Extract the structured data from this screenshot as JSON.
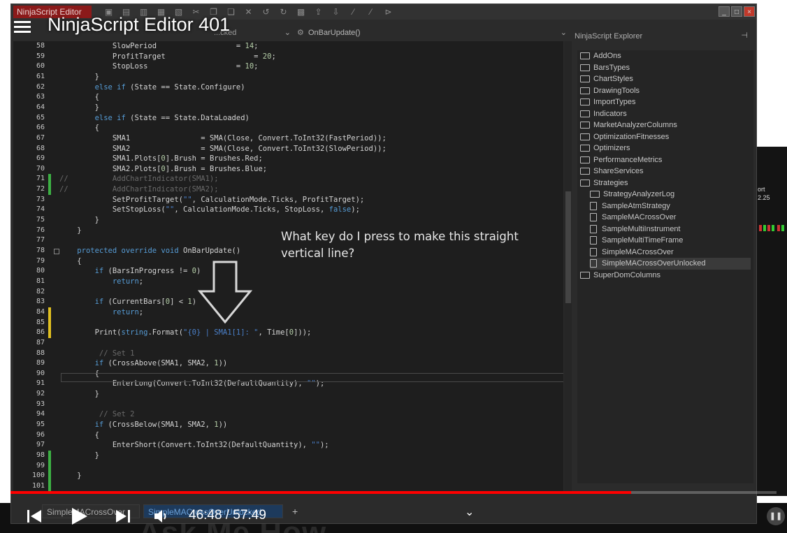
{
  "video": {
    "title": "NinjaScript Editor 401",
    "time": "46:48 / 57:49",
    "progress_fraction": 0.81,
    "accent_color": "#ff0000",
    "question": "What key do I press to make this straight vertical line?"
  },
  "window": {
    "title": "NinjaScript Editor",
    "combo_left": "...cked",
    "combo_right": "OnBarUpdate()",
    "controls": [
      "_",
      "□",
      "×"
    ]
  },
  "toolbar_icons": [
    "save-icon",
    "save-all-icon",
    "print-icon",
    "print-preview-icon",
    "properties-icon",
    "cut-icon",
    "copy-icon",
    "paste-icon",
    "delete-icon",
    "undo-icon",
    "redo-icon",
    "compile-icon",
    "export-icon",
    "import-icon",
    "comment-icon",
    "uncomment-icon",
    "vs-icon"
  ],
  "code_lines": [
    {
      "n": "58",
      "mark": "",
      "html": "            SlowPeriod                  = <span class='nm'>14</span>;"
    },
    {
      "n": "59",
      "mark": "",
      "html": "            ProfitTarget                    = <span class='nm'>20</span>;"
    },
    {
      "n": "60",
      "mark": "",
      "html": "            StopLoss                    = <span class='nm'>10</span>;"
    },
    {
      "n": "61",
      "mark": "",
      "html": "        }"
    },
    {
      "n": "62",
      "mark": "",
      "html": "        <span class='kw'>else if</span> (State == State.Configure)"
    },
    {
      "n": "63",
      "mark": "",
      "html": "        {"
    },
    {
      "n": "64",
      "mark": "",
      "html": "        }"
    },
    {
      "n": "65",
      "mark": "",
      "html": "        <span class='kw'>else if</span> (State == State.DataLoaded)"
    },
    {
      "n": "66",
      "mark": "",
      "html": "        {"
    },
    {
      "n": "67",
      "mark": "",
      "html": "            SMA1                = SMA(Close, Convert.ToInt32(FastPeriod));"
    },
    {
      "n": "68",
      "mark": "",
      "html": "            SMA2                = SMA(Close, Convert.ToInt32(SlowPeriod));"
    },
    {
      "n": "69",
      "mark": "",
      "html": "            SMA1.Plots[<span class='nm'>0</span>].Brush = Brushes.Red;"
    },
    {
      "n": "70",
      "mark": "",
      "html": "            SMA2.Plots[<span class='nm'>0</span>].Brush = Brushes.Blue;"
    },
    {
      "n": "71",
      "mark": "green",
      "html": "<span class='cm'>//          AddChartIndicator(SMA1);</span>"
    },
    {
      "n": "72",
      "mark": "green",
      "html": "<span class='cm'>//          AddChartIndicator(SMA2);</span>"
    },
    {
      "n": "73",
      "mark": "",
      "html": "            SetProfitTarget(<span class='st'>\"\"</span>, CalculationMode.Ticks, ProfitTarget);"
    },
    {
      "n": "74",
      "mark": "",
      "html": "            SetStopLoss(<span class='st'>\"\"</span>, CalculationMode.Ticks, StopLoss, <span class='kw'>false</span>);"
    },
    {
      "n": "75",
      "mark": "",
      "html": "        }"
    },
    {
      "n": "76",
      "mark": "",
      "html": "    }"
    },
    {
      "n": "77",
      "mark": "",
      "html": ""
    },
    {
      "n": "78",
      "mark": "",
      "html": "    <span class='kw'>protected override void</span> OnBarUpdate()"
    },
    {
      "n": "79",
      "mark": "",
      "html": "    {"
    },
    {
      "n": "80",
      "mark": "",
      "html": "        <span class='kw'>if</span> (BarsInProgress != <span class='nm'>0</span>)"
    },
    {
      "n": "81",
      "mark": "",
      "html": "            <span class='kw'>return</span>;"
    },
    {
      "n": "82",
      "mark": "",
      "html": ""
    },
    {
      "n": "83",
      "mark": "",
      "html": "        <span class='kw'>if</span> (CurrentBars[<span class='nm'>0</span>] &lt; <span class='nm'>1</span>)"
    },
    {
      "n": "84",
      "mark": "yellow",
      "html": "            <span class='kw'>return</span>;"
    },
    {
      "n": "85",
      "mark": "yellow",
      "html": ""
    },
    {
      "n": "86",
      "mark": "yellow",
      "html": "        Print(<span class='kw'>string</span>.Format(<span class='st'>\"{0} | SMA1[1]: \"</span>, Time[<span class='nm'>0</span>]));"
    },
    {
      "n": "87",
      "mark": "",
      "html": ""
    },
    {
      "n": "88",
      "mark": "",
      "html": "         <span class='cm'>// Set 1</span>"
    },
    {
      "n": "89",
      "mark": "",
      "html": "        <span class='kw'>if</span> (CrossAbove(SMA1, SMA2, <span class='nm'>1</span>))"
    },
    {
      "n": "90",
      "mark": "",
      "html": "        {"
    },
    {
      "n": "91",
      "mark": "",
      "html": "            EnterLong(Convert.ToInt32(DefaultQuantity), <span class='st'>\"\"</span>);"
    },
    {
      "n": "92",
      "mark": "",
      "html": "        }"
    },
    {
      "n": "93",
      "mark": "",
      "html": ""
    },
    {
      "n": "94",
      "mark": "",
      "html": "         <span class='cm'>// Set 2</span>"
    },
    {
      "n": "95",
      "mark": "",
      "html": "        <span class='kw'>if</span> (CrossBelow(SMA1, SMA2, <span class='nm'>1</span>))"
    },
    {
      "n": "96",
      "mark": "",
      "html": "        {"
    },
    {
      "n": "97",
      "mark": "",
      "html": "            EnterShort(Convert.ToInt32(DefaultQuantity), <span class='st'>\"\"</span>);"
    },
    {
      "n": "98",
      "mark": "green",
      "html": "        }"
    },
    {
      "n": "99",
      "mark": "green",
      "html": ""
    },
    {
      "n": "100",
      "mark": "green",
      "html": "    }"
    },
    {
      "n": "101",
      "mark": "green",
      "html": ""
    }
  ],
  "explorer": {
    "title": "NinjaScript Explorer",
    "pin": "⊣",
    "items": [
      {
        "label": "AddOns",
        "type": "folder",
        "indent": 0
      },
      {
        "label": "BarsTypes",
        "type": "folder",
        "indent": 0
      },
      {
        "label": "ChartStyles",
        "type": "folder",
        "indent": 0
      },
      {
        "label": "DrawingTools",
        "type": "folder",
        "indent": 0
      },
      {
        "label": "ImportTypes",
        "type": "folder",
        "indent": 0
      },
      {
        "label": "Indicators",
        "type": "folder",
        "indent": 0
      },
      {
        "label": "MarketAnalyzerColumns",
        "type": "folder",
        "indent": 0
      },
      {
        "label": "OptimizationFitnesses",
        "type": "folder",
        "indent": 0
      },
      {
        "label": "Optimizers",
        "type": "folder",
        "indent": 0
      },
      {
        "label": "PerformanceMetrics",
        "type": "folder",
        "indent": 0
      },
      {
        "label": "ShareServices",
        "type": "folder",
        "indent": 0
      },
      {
        "label": "Strategies",
        "type": "folder",
        "indent": 0
      },
      {
        "label": "StrategyAnalyzerLog",
        "type": "folder",
        "indent": 1
      },
      {
        "label": "SampleAtmStrategy",
        "type": "file",
        "indent": 1
      },
      {
        "label": "SampleMACrossOver",
        "type": "file",
        "indent": 1
      },
      {
        "label": "SampleMultiInstrument",
        "type": "file",
        "indent": 1
      },
      {
        "label": "SampleMultiTimeFrame",
        "type": "file",
        "indent": 1
      },
      {
        "label": "SimpleMACrossOver",
        "type": "file",
        "indent": 1
      },
      {
        "label": "SimpleMACrossOverUnlocked",
        "type": "file",
        "indent": 1,
        "selected": true
      },
      {
        "label": "SuperDomColumns",
        "type": "folder",
        "indent": 0
      }
    ]
  },
  "tabs": [
    {
      "label": "SimpleMACrossOver",
      "active": false
    },
    {
      "label": "SimpleMACrossOverUnlocked",
      "active": true
    }
  ],
  "chart_sliver": {
    "text1": "ort",
    "text2": "2.25"
  },
  "bottom_text": "Ask Me How"
}
